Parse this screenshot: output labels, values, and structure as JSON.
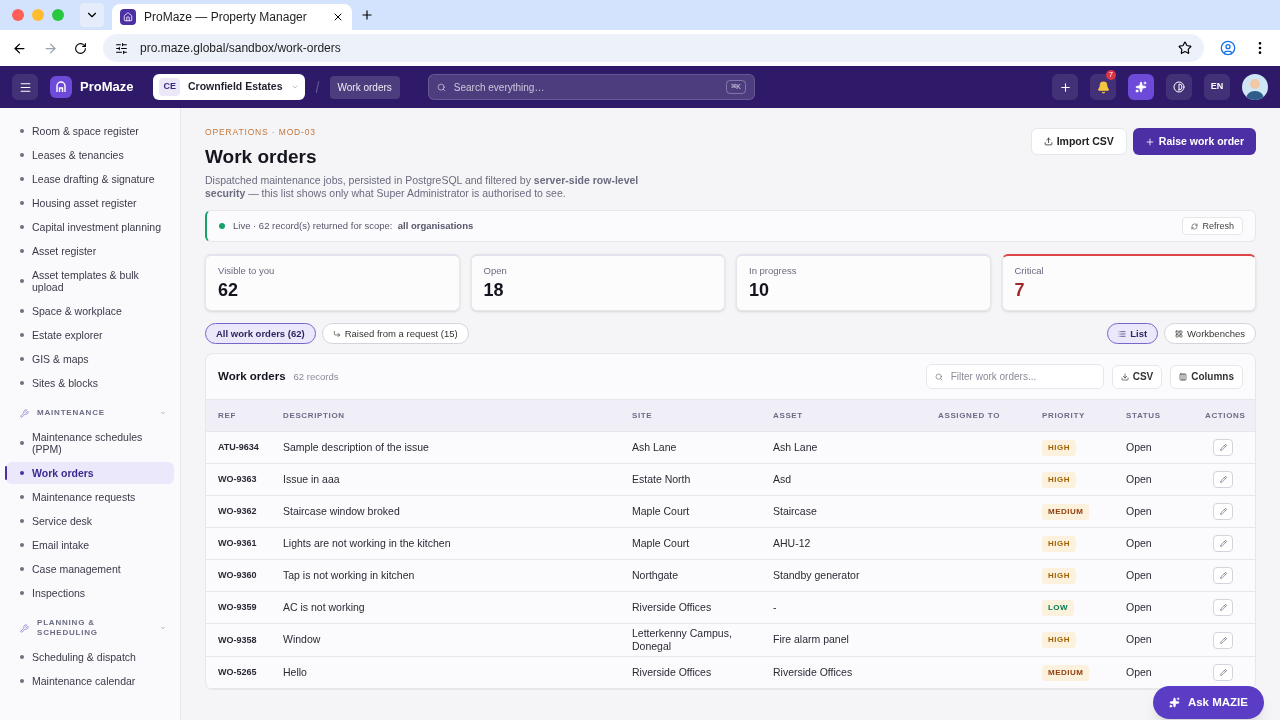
{
  "browser": {
    "tab_title": "ProMaze — Property Manager",
    "url": "pro.maze.global/sandbox/work-orders"
  },
  "header": {
    "brand": "ProMaze",
    "org": {
      "initials": "CE",
      "name": "Crownfield Estates"
    },
    "breadcrumb": "Work orders",
    "search": {
      "placeholder": "Search everything…",
      "shortcut": "⌘K"
    },
    "notifications": "7",
    "language": "EN"
  },
  "sidebar": [
    {
      "kind": "item",
      "label": "Room & space register",
      "selected": false
    },
    {
      "kind": "item",
      "label": "Leases & tenancies",
      "selected": false
    },
    {
      "kind": "item",
      "label": "Lease drafting & signature",
      "selected": false
    },
    {
      "kind": "item",
      "label": "Housing asset register",
      "selected": false
    },
    {
      "kind": "item",
      "label": "Capital investment planning",
      "selected": false
    },
    {
      "kind": "item",
      "label": "Asset register",
      "selected": false
    },
    {
      "kind": "item",
      "label": "Asset templates & bulk upload",
      "selected": false
    },
    {
      "kind": "item",
      "label": "Space & workplace",
      "selected": false
    },
    {
      "kind": "item",
      "label": "Estate explorer",
      "selected": false
    },
    {
      "kind": "item",
      "label": "GIS & maps",
      "selected": false
    },
    {
      "kind": "item",
      "label": "Sites & blocks",
      "selected": false
    },
    {
      "kind": "section",
      "label": "MAINTENANCE"
    },
    {
      "kind": "item",
      "label": "Maintenance schedules (PPM)",
      "selected": false
    },
    {
      "kind": "item",
      "label": "Work orders",
      "selected": true
    },
    {
      "kind": "item",
      "label": "Maintenance requests",
      "selected": false
    },
    {
      "kind": "item",
      "label": "Service desk",
      "selected": false
    },
    {
      "kind": "item",
      "label": "Email intake",
      "selected": false
    },
    {
      "kind": "item",
      "label": "Case management",
      "selected": false
    },
    {
      "kind": "item",
      "label": "Inspections",
      "selected": false
    },
    {
      "kind": "section",
      "label": "PLANNING & SCHEDULING"
    },
    {
      "kind": "item",
      "label": "Scheduling & dispatch",
      "selected": false
    },
    {
      "kind": "item",
      "label": "Maintenance calendar",
      "selected": false
    }
  ],
  "page": {
    "eyebrow": "OPERATIONS · MOD-03",
    "title": "Work orders",
    "description": "Dispatched maintenance jobs, persisted in PostgreSQL and filtered by **server-side row-level security** — this list shows only what Super Administrator is authorised to see.",
    "buttons": [
      "Import CSV",
      "Raise work order"
    ]
  },
  "banner": {
    "text": "Live · 62 record(s) returned for scope:  **all organisations**",
    "action": "Refresh"
  },
  "stats": [
    {
      "label": "Visible to you",
      "value": "62",
      "alert": false
    },
    {
      "label": "Open",
      "value": "18",
      "alert": false
    },
    {
      "label": "In progress",
      "value": "10",
      "alert": false
    },
    {
      "label": "Critical",
      "value": "7",
      "alert": true
    }
  ],
  "filters": [
    {
      "label": "All work orders (62)",
      "selected": true
    },
    {
      "label": "Raised from a request (15)",
      "selected": false
    }
  ],
  "views": [
    {
      "label": "List",
      "selected": true
    },
    {
      "label": "Workbenches",
      "selected": false
    }
  ],
  "table": {
    "title": "Work orders",
    "count": "62 records",
    "filter_placeholder": "Filter work orders...",
    "buttons": [
      "CSV",
      "Columns"
    ],
    "columns": [
      "REF",
      "DESCRIPTION",
      "SITE",
      "ASSET",
      "ASSIGNED TO",
      "PRIORITY",
      "STATUS",
      "ACTIONS"
    ],
    "rows": [
      {
        "ref": "ATU-9634",
        "description": "Sample description of the issue",
        "site": "Ash Lane",
        "asset": "Ash Lane",
        "priority": "HIGH",
        "color": "#a16207",
        "status": "Open"
      },
      {
        "ref": "WO-9363",
        "description": "Issue in aaa",
        "site": "Estate North",
        "asset": "Asd",
        "priority": "HIGH",
        "color": "#a16207",
        "status": "Open"
      },
      {
        "ref": "WO-9362",
        "description": "Staircase window broked",
        "site": "Maple Court",
        "asset": "Staircase",
        "priority": "MEDIUM",
        "color": "#92400e",
        "status": "Open"
      },
      {
        "ref": "WO-9361",
        "description": "Lights are not working in the kitchen",
        "site": "Maple Court",
        "asset": "AHU-12",
        "priority": "HIGH",
        "color": "#a16207",
        "status": "Open"
      },
      {
        "ref": "WO-9360",
        "description": "Tap is not working in kitchen",
        "site": "Northgate",
        "asset": "Standby generator",
        "priority": "HIGH",
        "color": "#a16207",
        "status": "Open"
      },
      {
        "ref": "WO-9359",
        "description": "AC is not working",
        "site": "Riverside Offices",
        "asset": "-",
        "priority": "LOW",
        "color": "#047857",
        "status": "Open"
      },
      {
        "ref": "WO-9358",
        "description": "Window",
        "site": "Letterkenny Campus, Donegal",
        "asset": "Fire alarm panel",
        "priority": "HIGH",
        "color": "#a16207",
        "status": "Open"
      },
      {
        "ref": "WO-5265",
        "description": "Hello",
        "site": "Riverside Offices",
        "asset": "Riverside Offices",
        "priority": "MEDIUM",
        "color": "#92400e",
        "status": "Open"
      }
    ]
  },
  "assistant": "Ask MAZIE"
}
